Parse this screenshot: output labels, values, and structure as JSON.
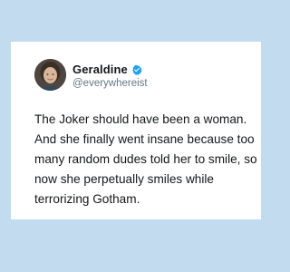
{
  "tweet": {
    "display_name": "Geraldine",
    "handle": "@everywhereist",
    "verified": true,
    "text_lines": [
      "The Joker should have been a woman.",
      "And she finally went insane because too",
      "many random dudes told her to smile, so",
      "now she perpetually smiles while",
      "terrorizing Gotham."
    ]
  },
  "colors": {
    "background": "#c3dbee",
    "card": "#ffffff",
    "verified_badge": "#1da1f2",
    "handle": "#657786",
    "text": "#14171a"
  },
  "icons": {
    "verified": "verified-badge-icon",
    "avatar": "profile-photo"
  }
}
